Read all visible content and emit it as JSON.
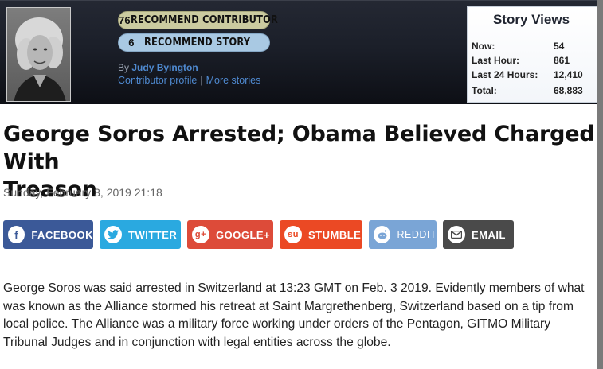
{
  "header": {
    "recommend_contributor": {
      "count": "76",
      "label": "RECOMMEND CONTRIBUTOR"
    },
    "recommend_story": {
      "count": "6",
      "label": "RECOMMEND STORY"
    },
    "byline_prefix": "By",
    "author": "Judy Byington",
    "contributor_profile": "Contributor profile",
    "separator": "|",
    "more_stories": "More stories"
  },
  "story_views": {
    "title": "Story Views",
    "rows": [
      {
        "label": "Now:",
        "value": "54"
      },
      {
        "label": "Last Hour:",
        "value": "861"
      },
      {
        "label": "Last 24 Hours:",
        "value": "12,410"
      },
      {
        "label": "Total:",
        "value": "68,883"
      }
    ]
  },
  "article": {
    "title_line1": "George Soros Arrested; Obama Believed Charged With",
    "title_line2": "Treason",
    "date": "Sunday, February 3, 2019 21:18",
    "body_lines": [
      "George Soros was said arrested in Switzerland at 13:23 GMT on Feb. 3 2019. Evidently members of what",
      "was known as the Alliance stormed his retreat at Saint Margrethenberg, Switzerland based on a tip from",
      "local police. The Alliance was a military force working under orders of the Pentagon, GITMO Military",
      "Tribunal Judges and in conjunction with legal entities across the globe."
    ]
  },
  "share": {
    "facebook": "FACEBOOK",
    "twitter": "TWITTER",
    "google": "GOOGLE+",
    "stumble": "STUMBLE",
    "reddit": "REDDIT",
    "email": "EMAIL"
  },
  "colors": {
    "facebook": "#3b5998",
    "twitter": "#2aa9e0",
    "google": "#dd4b39",
    "stumble": "#eb4924",
    "reddit": "#7aa5d6",
    "email": "#4a4a4a"
  }
}
